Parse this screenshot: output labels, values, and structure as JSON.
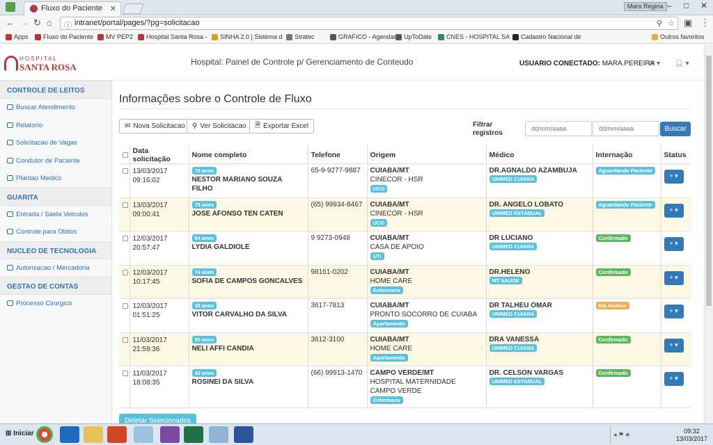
{
  "browser": {
    "tab_title": "Fluxo do Paciente",
    "profile": "Mara Regina",
    "url": "intranet/portal/pages/?pg=solicitacao",
    "bookmarks": [
      "Apps",
      "Fluxo do Paciente",
      "MV PEP2",
      "Hospital Santa Rosa -",
      "SINHA 2.0 | Sistema d",
      "Stratec",
      "GRAFICO - Agendam",
      "UpToDate",
      "CNES - HOSPITAL SA",
      "Cadastro Nacional de",
      "Outros favoritos"
    ]
  },
  "header": {
    "logo_top": "HOSPITAL",
    "logo_bottom": "SANTA ROSA",
    "title": "Hospital: Painel de Controle p/ Gerenciamento de Conteudo",
    "user_label": "USUARIO CONECTADO:",
    "user_name": "MARA.PEREIRA"
  },
  "sidebar": [
    {
      "section": "CONTROLE DE LEITOS",
      "items": [
        "Buscar Atendimento",
        "Relatorio",
        "Solicitacao de Vagas",
        "Condutor de Paciente",
        "Plantao Medico"
      ]
    },
    {
      "section": "GUARITA",
      "items": [
        "Entrada / Saida Veiculos",
        "Controle para Obitos"
      ]
    },
    {
      "section": "NUCLEO DE TECNOLOGIA",
      "items": [
        "Autorizacao / Mercadoria"
      ]
    },
    {
      "section": "GESTAO DE CONTAS",
      "items": [
        "Processo Cirurgico"
      ]
    }
  ],
  "main": {
    "title": "Informações sobre o Controle de Fluxo",
    "buttons": {
      "nova": "Nova Solicitacao",
      "ver": "Ver Solicitacao",
      "exportar": "Exportar Excel"
    },
    "filter_label_1": "Filtrar",
    "filter_label_2": "registros",
    "date_placeholder": "dd/mm/aaaa",
    "buscar": "Buscar",
    "delete_button": "Deletar Selecionados"
  },
  "table": {
    "columns": [
      "Data solicitação",
      "Nome completo",
      "Telefone",
      "Origem",
      "Médico",
      "Internação",
      "Status"
    ],
    "rows": [
      {
        "date": "13/03/2017",
        "time": "09:16:02",
        "age": "70 anos",
        "name": "NESTOR MARIANO SOUZA FILHO",
        "phone": "65-9-9277-9887",
        "city": "CUIABA/MT",
        "unit": "CINECOR - HSR",
        "sector": "UCO",
        "doctor": "DR.AGNALDO AZAMBUJA",
        "plan": "UNIMED CUIABA",
        "status": "Aguardando Paciente",
        "status_type": "info"
      },
      {
        "date": "13/03/2017",
        "time": "09:00:41",
        "age": "78 anos",
        "name": "JOSE AFONSO TEN CATEN",
        "phone": "(65) 99934-8467",
        "city": "CUIABA/MT",
        "unit": "CINECOR - HSR",
        "sector": "UCO",
        "doctor": "DR. ANGELO LOBATO",
        "plan": "UNIMED ESTADUAL",
        "status": "Aguardando Paciente",
        "status_type": "info"
      },
      {
        "date": "12/03/2017",
        "time": "20:57:47",
        "age": "94 anos",
        "name": "LYDIA GALDIOLE",
        "phone": "9 9273-0948",
        "city": "CUIABA/MT",
        "unit": "CASA DE APOIO",
        "sector": "UTI",
        "doctor": "DR LUCIANO",
        "plan": "UNIMED CUIABA",
        "status": "Confirmado",
        "status_type": "success"
      },
      {
        "date": "12/03/2017",
        "time": "10:17:45",
        "age": "74 anos",
        "name": "SOFIA DE CAMPOS GONCALVES",
        "phone": "98161-0202",
        "city": "CUIABA/MT",
        "unit": "HOME CARE",
        "sector": "Enfermaria",
        "doctor": "DR.HELENO",
        "plan": "MT SAUDE",
        "status": "Confirmado",
        "status_type": "success"
      },
      {
        "date": "12/03/2017",
        "time": "01:51:25",
        "age": "38 anos",
        "name": "VITOR CARVALHO DA SILVA",
        "phone": "3617-7813",
        "city": "CUIABA/MT",
        "unit": "PRONTO SOCORRO DE CUIABA",
        "sector": "Apartamento",
        "doctor": "DR TALHEU OMAR",
        "plan": "UNIMED CUIABA",
        "status": "Em Analise",
        "status_type": "warning"
      },
      {
        "date": "11/03/2017",
        "time": "21:59:36",
        "age": "90 anos",
        "name": "NELI AFFI CANDIA",
        "phone": "3612-3100",
        "city": "CUIABA/MT",
        "unit": "HOME CARE",
        "sector": "Apartamento",
        "doctor": "DRA VANESSA",
        "plan": "UNIMED CUIABA",
        "status": "Confirmado",
        "status_type": "success"
      },
      {
        "date": "11/03/2017",
        "time": "18:08:35",
        "age": "32 anos",
        "name": "ROSINEI DA SILVA",
        "phone": "(66) 99913-1470",
        "city": "CAMPO VERDE/MT",
        "unit": "HOSPITAL MATERNIDADE CAMPO VERDE",
        "sector": "Enfermaria",
        "doctor": "DR. CELSON VARGAS",
        "plan": "UNIMED ESTADUAL",
        "status": "Confirmado",
        "status_type": "success"
      }
    ]
  },
  "taskbar": {
    "start": "Iniciar",
    "time": "09:32",
    "date": "13/03/2017"
  }
}
